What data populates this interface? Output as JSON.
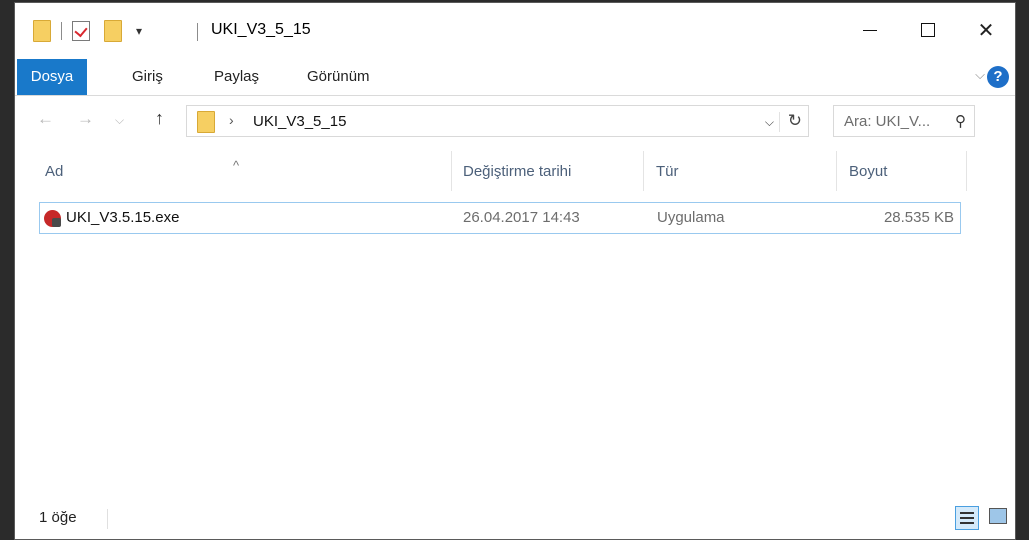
{
  "window": {
    "title": "UKI_V3_5_15"
  },
  "ribbon": {
    "tabs": [
      "Dosya",
      "Giriş",
      "Paylaş",
      "Görünüm"
    ]
  },
  "address": {
    "path": "UKI_V3_5_15",
    "search_placeholder": "Ara: UKI_V..."
  },
  "columns": {
    "name": "Ad",
    "date": "Değiştirme tarihi",
    "type": "Tür",
    "size": "Boyut"
  },
  "files": [
    {
      "name": "UKI_V3.5.15.exe",
      "date": "26.04.2017 14:43",
      "type": "Uygulama",
      "size": "28.535 KB",
      "icon": "application-exe-icon"
    }
  ],
  "status": {
    "item_count": "1 öğe"
  },
  "colors": {
    "accent": "#1979ca",
    "selection_border": "#99c9ef",
    "header_text": "#4c607a"
  }
}
